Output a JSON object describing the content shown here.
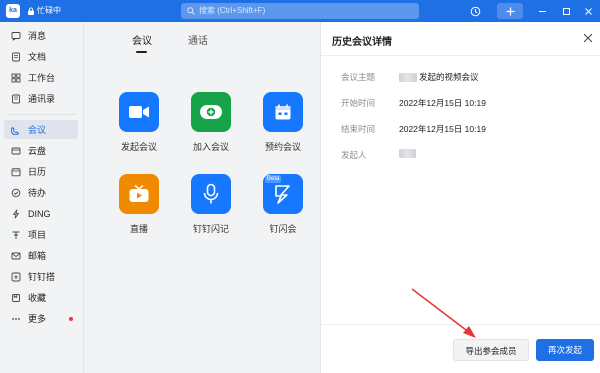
{
  "titlebar": {
    "avatar_text": "ka",
    "status_text": "忙碌中",
    "search_placeholder": "搜索 (Ctrl+Shift+F)"
  },
  "sidebar": {
    "items": [
      {
        "label": "消息",
        "icon": "message-icon"
      },
      {
        "label": "文档",
        "icon": "document-icon"
      },
      {
        "label": "工作台",
        "icon": "workbench-icon"
      },
      {
        "label": "通讯录",
        "icon": "contacts-icon"
      },
      {
        "label": "会议",
        "icon": "meeting-icon",
        "active": true
      },
      {
        "label": "云盘",
        "icon": "cloud-drive-icon"
      },
      {
        "label": "日历",
        "icon": "calendar-icon"
      },
      {
        "label": "待办",
        "icon": "todo-icon"
      },
      {
        "label": "DING",
        "icon": "ding-icon"
      },
      {
        "label": "项目",
        "icon": "project-icon"
      },
      {
        "label": "邮箱",
        "icon": "mail-icon"
      },
      {
        "label": "钉钉搭",
        "icon": "dingda-icon"
      },
      {
        "label": "收藏",
        "icon": "favorite-icon"
      },
      {
        "label": "更多",
        "icon": "more-icon"
      }
    ]
  },
  "main": {
    "tabs": [
      {
        "label": "会议",
        "active": true
      },
      {
        "label": "通话",
        "active": false
      }
    ],
    "apps": [
      {
        "label": "发起会议",
        "color": "#1677ff",
        "icon": "video-camera-icon"
      },
      {
        "label": "加入会议",
        "color": "#16a34a",
        "icon": "join-meeting-icon"
      },
      {
        "label": "预约会议",
        "color": "#1677ff",
        "icon": "schedule-calendar-icon"
      },
      {
        "label": "直播",
        "color": "#f08a00",
        "icon": "live-tv-icon"
      },
      {
        "label": "钉钉闪记",
        "color": "#1677ff",
        "icon": "microphone-icon"
      },
      {
        "label": "钉闪会",
        "color": "#1677ff",
        "icon": "flash-icon",
        "badge": "Beta"
      }
    ]
  },
  "panel": {
    "title": "历史会议详情",
    "fields": [
      {
        "key": "会议主题",
        "value": "发起的视频会议"
      },
      {
        "key": "开始时间",
        "value": "2022年12月15日 10:19"
      },
      {
        "key": "结束时间",
        "value": "2022年12月15日 10:19"
      },
      {
        "key": "发起人",
        "value": ""
      }
    ],
    "export_label": "导出参会成员",
    "restart_label": "再次发起"
  },
  "colors": {
    "brand": "#1f6fe5",
    "annotation_arrow": "#e53935"
  }
}
